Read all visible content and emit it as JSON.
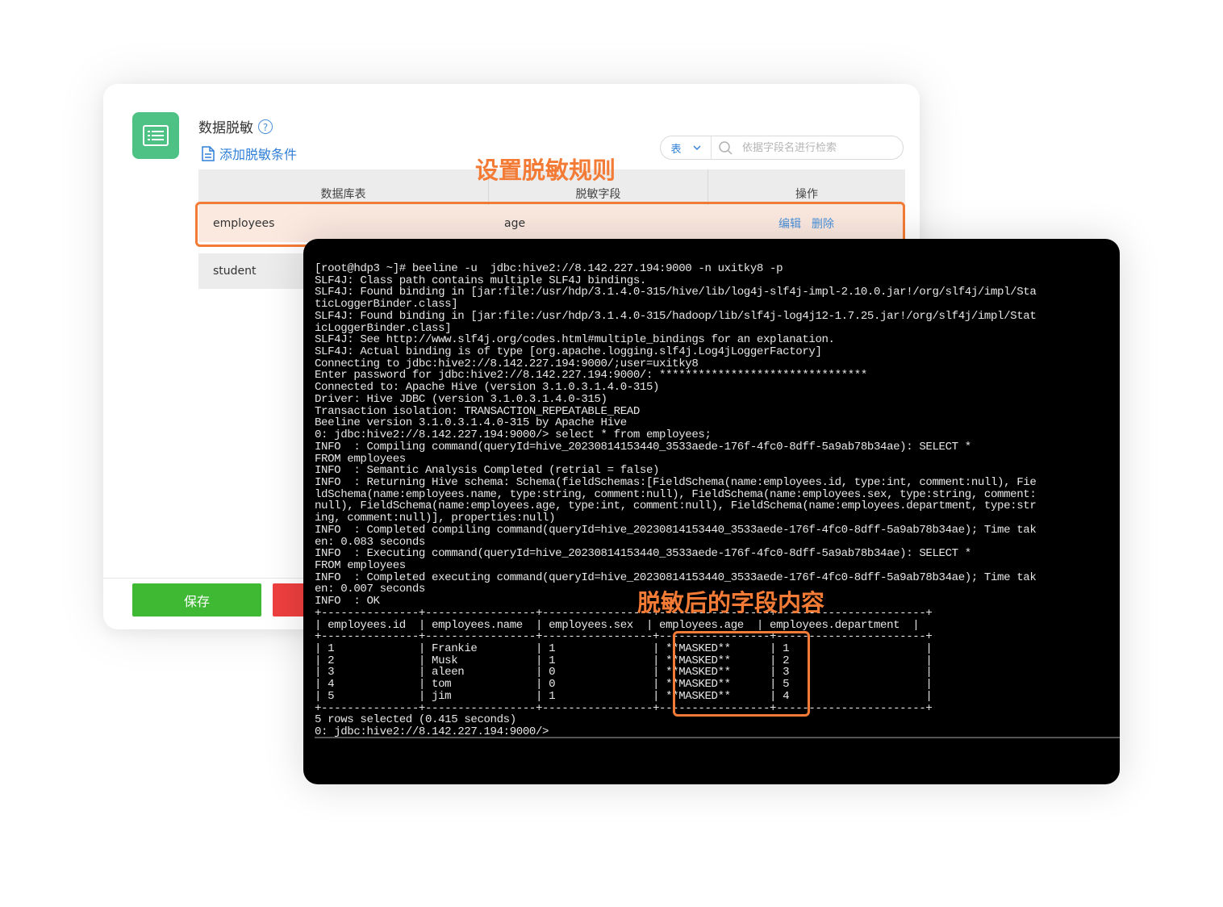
{
  "panel": {
    "title": "数据脱敏",
    "help_symbol": "?",
    "add_condition": "添加脱敏条件",
    "search": {
      "type_value": "表",
      "placeholder": "依据字段名进行检索"
    },
    "columns": [
      "数据库表",
      "脱敏字段",
      "操作"
    ],
    "rows": [
      {
        "table": "employees",
        "field": "age",
        "edit": "编辑",
        "delete": "删除"
      },
      {
        "table": "student"
      }
    ],
    "save_label": "保存"
  },
  "annotations": {
    "rule": "设置脱敏规则",
    "result": "脱敏后的字段内容"
  },
  "colors": {
    "accent_green": "#4ec184",
    "save_green": "#3fb934",
    "link_blue": "#2f7fd8",
    "highlight_orange": "#f47b35",
    "terminal_bg": "#000000"
  },
  "terminal": {
    "lines": [
      "[root@hdp3 ~]# beeline -u  jdbc:hive2://8.142.227.194:9000 -n uxitky8 -p",
      "SLF4J: Class path contains multiple SLF4J bindings.",
      "SLF4J: Found binding in [jar:file:/usr/hdp/3.1.4.0-315/hive/lib/log4j-slf4j-impl-2.10.0.jar!/org/slf4j/impl/Sta",
      "ticLoggerBinder.class]",
      "SLF4J: Found binding in [jar:file:/usr/hdp/3.1.4.0-315/hadoop/lib/slf4j-log4j12-1.7.25.jar!/org/slf4j/impl/Stat",
      "icLoggerBinder.class]",
      "SLF4J: See http://www.slf4j.org/codes.html#multiple_bindings for an explanation.",
      "SLF4J: Actual binding is of type [org.apache.logging.slf4j.Log4jLoggerFactory]",
      "Connecting to jdbc:hive2://8.142.227.194:9000/;user=uxitky8",
      "Enter password for jdbc:hive2://8.142.227.194:9000/: ********************************",
      "Connected to: Apache Hive (version 3.1.0.3.1.4.0-315)",
      "Driver: Hive JDBC (version 3.1.0.3.1.4.0-315)",
      "Transaction isolation: TRANSACTION_REPEATABLE_READ",
      "Beeline version 3.1.0.3.1.4.0-315 by Apache Hive",
      "0: jdbc:hive2://8.142.227.194:9000/> select * from employees;",
      "INFO  : Compiling command(queryId=hive_20230814153440_3533aede-176f-4fc0-8dff-5a9ab78b34ae): SELECT *",
      "FROM employees",
      "INFO  : Semantic Analysis Completed (retrial = false)",
      "INFO  : Returning Hive schema: Schema(fieldSchemas:[FieldSchema(name:employees.id, type:int, comment:null), Fie",
      "ldSchema(name:employees.name, type:string, comment:null), FieldSchema(name:employees.sex, type:string, comment:",
      "null), FieldSchema(name:employees.age, type:int, comment:null), FieldSchema(name:employees.department, type:str",
      "ing, comment:null)], properties:null)",
      "INFO  : Completed compiling command(queryId=hive_20230814153440_3533aede-176f-4fc0-8dff-5a9ab78b34ae); Time tak",
      "en: 0.083 seconds",
      "INFO  : Executing command(queryId=hive_20230814153440_3533aede-176f-4fc0-8dff-5a9ab78b34ae): SELECT *",
      "FROM employees",
      "INFO  : Completed executing command(queryId=hive_20230814153440_3533aede-176f-4fc0-8dff-5a9ab78b34ae); Time tak",
      "en: 0.007 seconds",
      "INFO  : OK",
      "+---------------+-----------------+-----------------+-----------------+-----------------------+",
      "| employees.id  | employees.name  | employees.sex  | employees.age  | employees.department  |",
      "+---------------+-----------------+-----------------+-----------------+-----------------------+",
      "| 1             | Frankie         | 1               | **MASKED**      | 1                     |",
      "| 2             | Musk            | 1               | **MASKED**      | 2                     |",
      "| 3             | aleen           | 0               | **MASKED**      | 3                     |",
      "| 4             | tom             | 0               | **MASKED**      | 5                     |",
      "| 5             | jim             | 1               | **MASKED**      | 4                     |",
      "+---------------+-----------------+-----------------+-----------------+-----------------------+",
      "5 rows selected (0.415 seconds)",
      "0: jdbc:hive2://8.142.227.194:9000/>"
    ]
  }
}
